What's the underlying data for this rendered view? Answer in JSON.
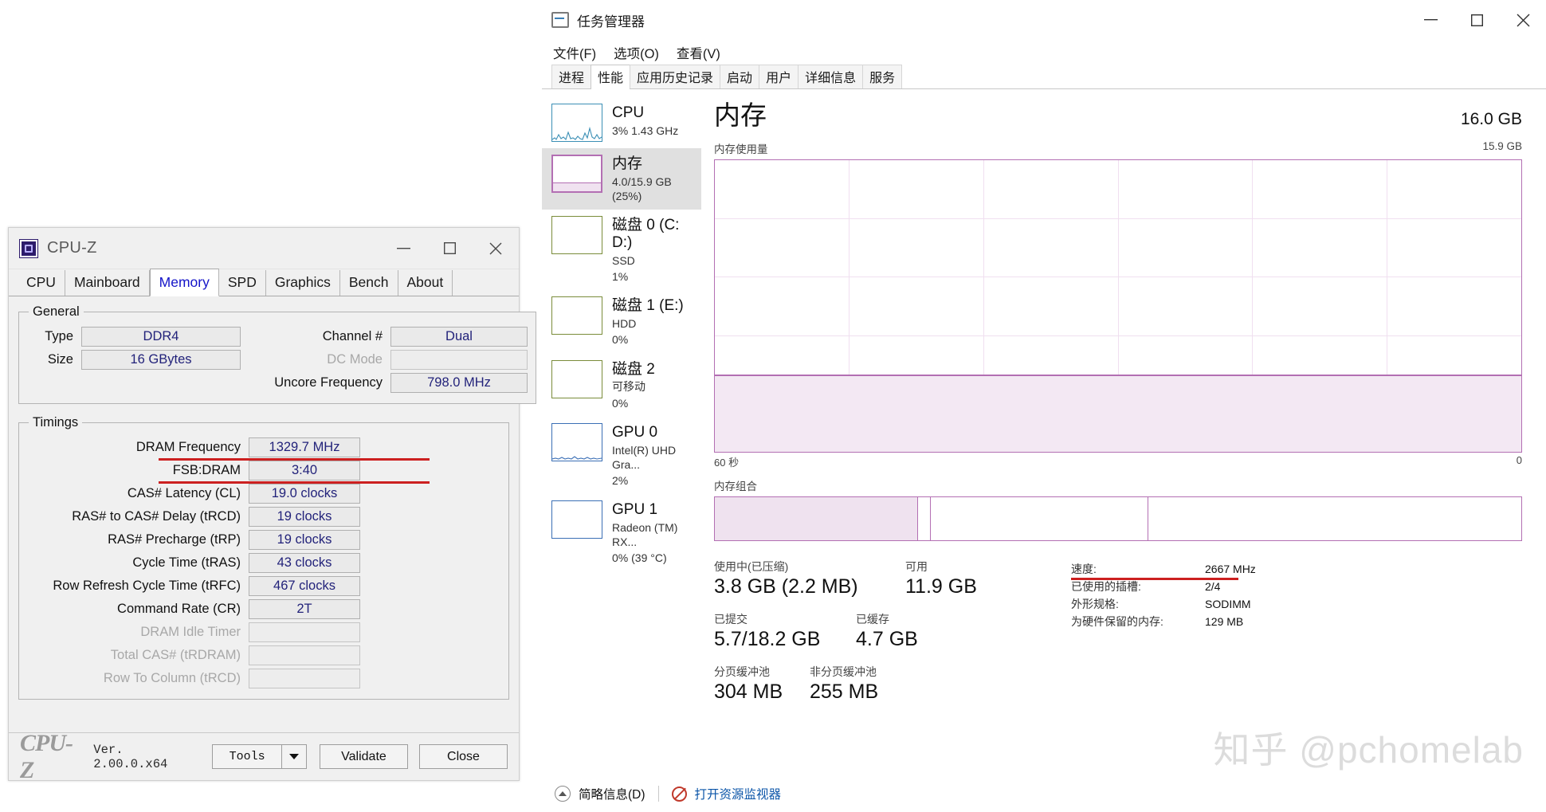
{
  "cpuz": {
    "title": "CPU-Z",
    "window_buttons": {
      "minimize": "minimize-icon",
      "maximize": "maximize-icon",
      "close": "close-icon"
    },
    "tabs": [
      {
        "label": "CPU",
        "active": false
      },
      {
        "label": "Mainboard",
        "active": false
      },
      {
        "label": "Memory",
        "active": true
      },
      {
        "label": "SPD",
        "active": false
      },
      {
        "label": "Graphics",
        "active": false
      },
      {
        "label": "Bench",
        "active": false
      },
      {
        "label": "About",
        "active": false
      }
    ],
    "general": {
      "legend": "General",
      "type_label": "Type",
      "type_value": "DDR4",
      "size_label": "Size",
      "size_value": "16 GBytes",
      "channel_label": "Channel #",
      "channel_value": "Dual",
      "dc_mode_label": "DC Mode",
      "dc_mode_value": "",
      "uncore_label": "Uncore Frequency",
      "uncore_value": "798.0 MHz"
    },
    "timings": {
      "legend": "Timings",
      "rows": [
        {
          "label": "DRAM Frequency",
          "value": "1329.7 MHz",
          "dim": false
        },
        {
          "label": "FSB:DRAM",
          "value": "3:40",
          "dim": false
        },
        {
          "label": "CAS# Latency (CL)",
          "value": "19.0 clocks",
          "dim": false
        },
        {
          "label": "RAS# to CAS# Delay (tRCD)",
          "value": "19 clocks",
          "dim": false
        },
        {
          "label": "RAS# Precharge (tRP)",
          "value": "19 clocks",
          "dim": false
        },
        {
          "label": "Cycle Time (tRAS)",
          "value": "43 clocks",
          "dim": false
        },
        {
          "label": "Row Refresh Cycle Time (tRFC)",
          "value": "467 clocks",
          "dim": false
        },
        {
          "label": "Command Rate (CR)",
          "value": "2T",
          "dim": false
        },
        {
          "label": "DRAM Idle Timer",
          "value": "",
          "dim": true
        },
        {
          "label": "Total CAS# (tRDRAM)",
          "value": "",
          "dim": true
        },
        {
          "label": "Row To Column (tRCD)",
          "value": "",
          "dim": true
        }
      ]
    },
    "footer": {
      "logo": "CPU-Z",
      "version": "Ver. 2.00.0.x64",
      "tools": "Tools",
      "validate": "Validate",
      "close": "Close"
    },
    "annotation_color": "#cc2020"
  },
  "taskmgr": {
    "title": "任务管理器",
    "menu": [
      "文件(F)",
      "选项(O)",
      "查看(V)"
    ],
    "window_buttons": {
      "minimize": "minimize-icon",
      "maximize": "maximize-icon",
      "close": "close-icon"
    },
    "tabs": [
      {
        "label": "进程",
        "active": false
      },
      {
        "label": "性能",
        "active": true
      },
      {
        "label": "应用历史记录",
        "active": false
      },
      {
        "label": "启动",
        "active": false
      },
      {
        "label": "用户",
        "active": false
      },
      {
        "label": "详细信息",
        "active": false
      },
      {
        "label": "服务",
        "active": false
      }
    ],
    "sidebar": [
      {
        "name": "CPU",
        "sub1": "3% 1.43 GHz",
        "sub2": "",
        "color": "#3b8fb5",
        "selected": false
      },
      {
        "name": "内存",
        "sub1": "4.0/15.9 GB (25%)",
        "sub2": "",
        "color": "#b36fb3",
        "selected": true
      },
      {
        "name": "磁盘 0 (C: D:)",
        "sub1": "SSD",
        "sub2": "1%",
        "color": "#7a8c3a",
        "selected": false
      },
      {
        "name": "磁盘 1 (E:)",
        "sub1": "HDD",
        "sub2": "0%",
        "color": "#7a8c3a",
        "selected": false
      },
      {
        "name": "磁盘 2",
        "sub1": "可移动",
        "sub2": "0%",
        "color": "#7a8c3a",
        "selected": false
      },
      {
        "name": "GPU 0",
        "sub1": "Intel(R) UHD Gra...",
        "sub2": "2%",
        "color": "#3b6fb5",
        "selected": false
      },
      {
        "name": "GPU 1",
        "sub1": "Radeon (TM) RX...",
        "sub2": "0% (39 °C)",
        "color": "#3b6fb5",
        "selected": false
      }
    ],
    "memory_page": {
      "title": "内存",
      "total": "16.0 GB",
      "graph_label": "内存使用量",
      "graph_max": "15.9 GB",
      "axis_left": "60 秒",
      "axis_right": "0",
      "composition_label": "内存组合",
      "stats": [
        {
          "label": "使用中(已压缩)",
          "value": "3.8 GB (2.2 MB)"
        },
        {
          "label": "可用",
          "value": "11.9 GB"
        },
        {
          "label": "已提交",
          "value": "5.7/18.2 GB"
        },
        {
          "label": "已缓存",
          "value": "4.7 GB"
        },
        {
          "label": "分页缓冲池",
          "value": "304 MB"
        },
        {
          "label": "非分页缓冲池",
          "value": "255 MB"
        }
      ],
      "details": [
        {
          "key": "速度:",
          "value": "2667 MHz"
        },
        {
          "key": "已使用的插槽:",
          "value": "2/4"
        },
        {
          "key": "外形规格:",
          "value": "SODIMM"
        },
        {
          "key": "为硬件保留的内存:",
          "value": "129 MB"
        }
      ],
      "accent_color": "#b36fb3",
      "annotation_color": "#cc2020"
    },
    "footer": {
      "brief": "简略信息(D)",
      "resmon": "打开资源监视器"
    }
  },
  "watermark": "知乎 @pchomelab"
}
